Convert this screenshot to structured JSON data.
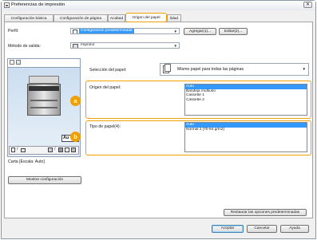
{
  "window": {
    "title": "Preferencias de impresión"
  },
  "tabs": [
    {
      "label": "Configuración básica"
    },
    {
      "label": "Configuración de página"
    },
    {
      "label": "Acabad"
    },
    {
      "label": "Origen del papel"
    },
    {
      "label": "lidad"
    }
  ],
  "profile": {
    "label": "Perfil:",
    "value": "Configuración predeterminada",
    "add_label": "Agregar(1)...",
    "edit_label": "Editar(2)..."
  },
  "output": {
    "label": "Método de salida:",
    "value": "Imprimir"
  },
  "preview": {
    "button_text": "Au",
    "caption": "Carta [Escala: Auto]",
    "show_config_label": "Mostrar configuración"
  },
  "paper_selection": {
    "label": "Selección del papel:",
    "value": "Mismo papel para todas las páginas"
  },
  "paper_source": {
    "label": "Origen del papel:",
    "items": [
      "Auto",
      "Bandeja multiuso",
      "Cassette 1",
      "Cassette 2"
    ],
    "selected_index": 0,
    "badge": "a"
  },
  "paper_type": {
    "label": "Tipo de papel(4):",
    "items": [
      "Auto",
      "Normal 2 [70-84 g/m2]"
    ],
    "selected_index": 0,
    "badge": "b"
  },
  "restore_label": "Restaurar las opciones predeterminadas",
  "footer": {
    "accept_label": "Aceptar",
    "cancel_label": "Cancelar",
    "help_label": "Ayuda"
  },
  "colors": {
    "accent": "#f0a000",
    "selection": "#3399ff"
  }
}
